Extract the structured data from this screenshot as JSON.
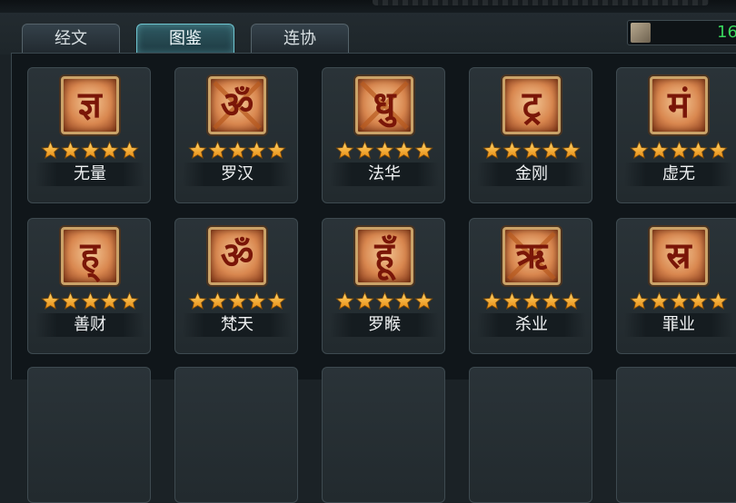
{
  "tabs": [
    {
      "label": "经文",
      "active": false
    },
    {
      "label": "图鉴",
      "active": true
    },
    {
      "label": "连协",
      "active": false
    }
  ],
  "counter": {
    "value": "16",
    "icon": "scroll-icon"
  },
  "accent_color": "#6fc5d0",
  "star_color": "#f6a623",
  "cards": [
    {
      "name": "无量",
      "stars": 5,
      "rune": "ज्ञ",
      "crossed": false
    },
    {
      "name": "罗汉",
      "stars": 5,
      "rune": "ॐ",
      "crossed": true
    },
    {
      "name": "法华",
      "stars": 5,
      "rune": "धु",
      "crossed": true
    },
    {
      "name": "金刚",
      "stars": 5,
      "rune": "ट्र",
      "crossed": false
    },
    {
      "name": "虚无",
      "stars": 5,
      "rune": "मं",
      "crossed": false
    },
    {
      "name": "善财",
      "stars": 5,
      "rune": "ह्",
      "crossed": false
    },
    {
      "name": "梵天",
      "stars": 5,
      "rune": "ॐ",
      "crossed": false
    },
    {
      "name": "罗睺",
      "stars": 5,
      "rune": "हूँ",
      "crossed": false
    },
    {
      "name": "杀业",
      "stars": 5,
      "rune": "ऋ",
      "crossed": true
    },
    {
      "name": "罪业",
      "stars": 5,
      "rune": "स्र",
      "crossed": false
    }
  ]
}
